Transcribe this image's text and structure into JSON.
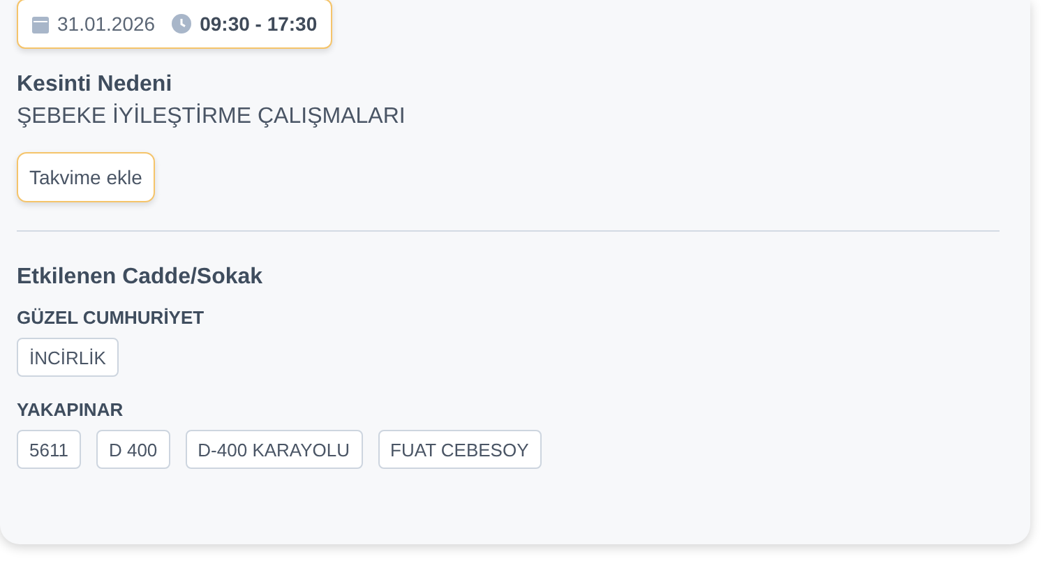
{
  "schedule": {
    "date": "31.01.2026",
    "time": "09:30 - 17:30"
  },
  "reason": {
    "label": "Kesinti Nedeni",
    "value": "ŞEBEKE İYİLEŞTİRME ÇALIŞMALARI"
  },
  "calendar_button": "Takvime ekle",
  "affected": {
    "title": "Etkilenen Cadde/Sokak",
    "groups": [
      {
        "name": "GÜZEL CUMHURİYET",
        "streets": [
          "İNCİRLİK"
        ]
      },
      {
        "name": "YAKAPINAR",
        "streets": [
          "5611",
          "D 400",
          "D-400 KARAYOLU",
          "FUAT CEBESOY"
        ]
      }
    ]
  }
}
